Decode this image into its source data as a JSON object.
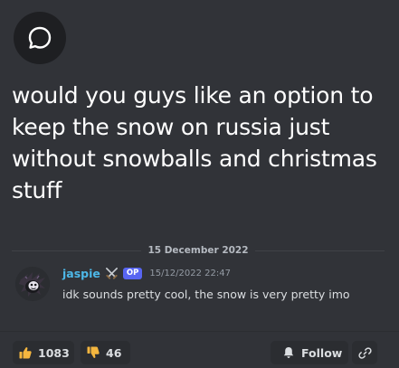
{
  "thread": {
    "icon": "chat-bubble-icon",
    "title": "would you guys like an option to keep the snow on russia just without snowballs and christmas stuff"
  },
  "divider": {
    "date": "15 December 2022"
  },
  "message": {
    "author": "jaspie",
    "author_color": "#4db8e8",
    "role_icon": "crossed-swords-icon",
    "op_badge": "OP",
    "timestamp": "15/12/2022 22:47",
    "body": "idk sounds pretty cool, the snow is very pretty imo"
  },
  "actions": {
    "upvote": {
      "icon": "thumbs-up-icon",
      "count": "1083"
    },
    "downvote": {
      "icon": "thumbs-down-icon",
      "count": "46"
    },
    "follow": {
      "icon": "bell-icon",
      "label": "Follow"
    },
    "link": {
      "icon": "link-icon"
    }
  },
  "colors": {
    "background": "#313338",
    "button_bg": "#2b2d31",
    "badge": "#5865f2",
    "thumbs": "#f4b63f"
  }
}
